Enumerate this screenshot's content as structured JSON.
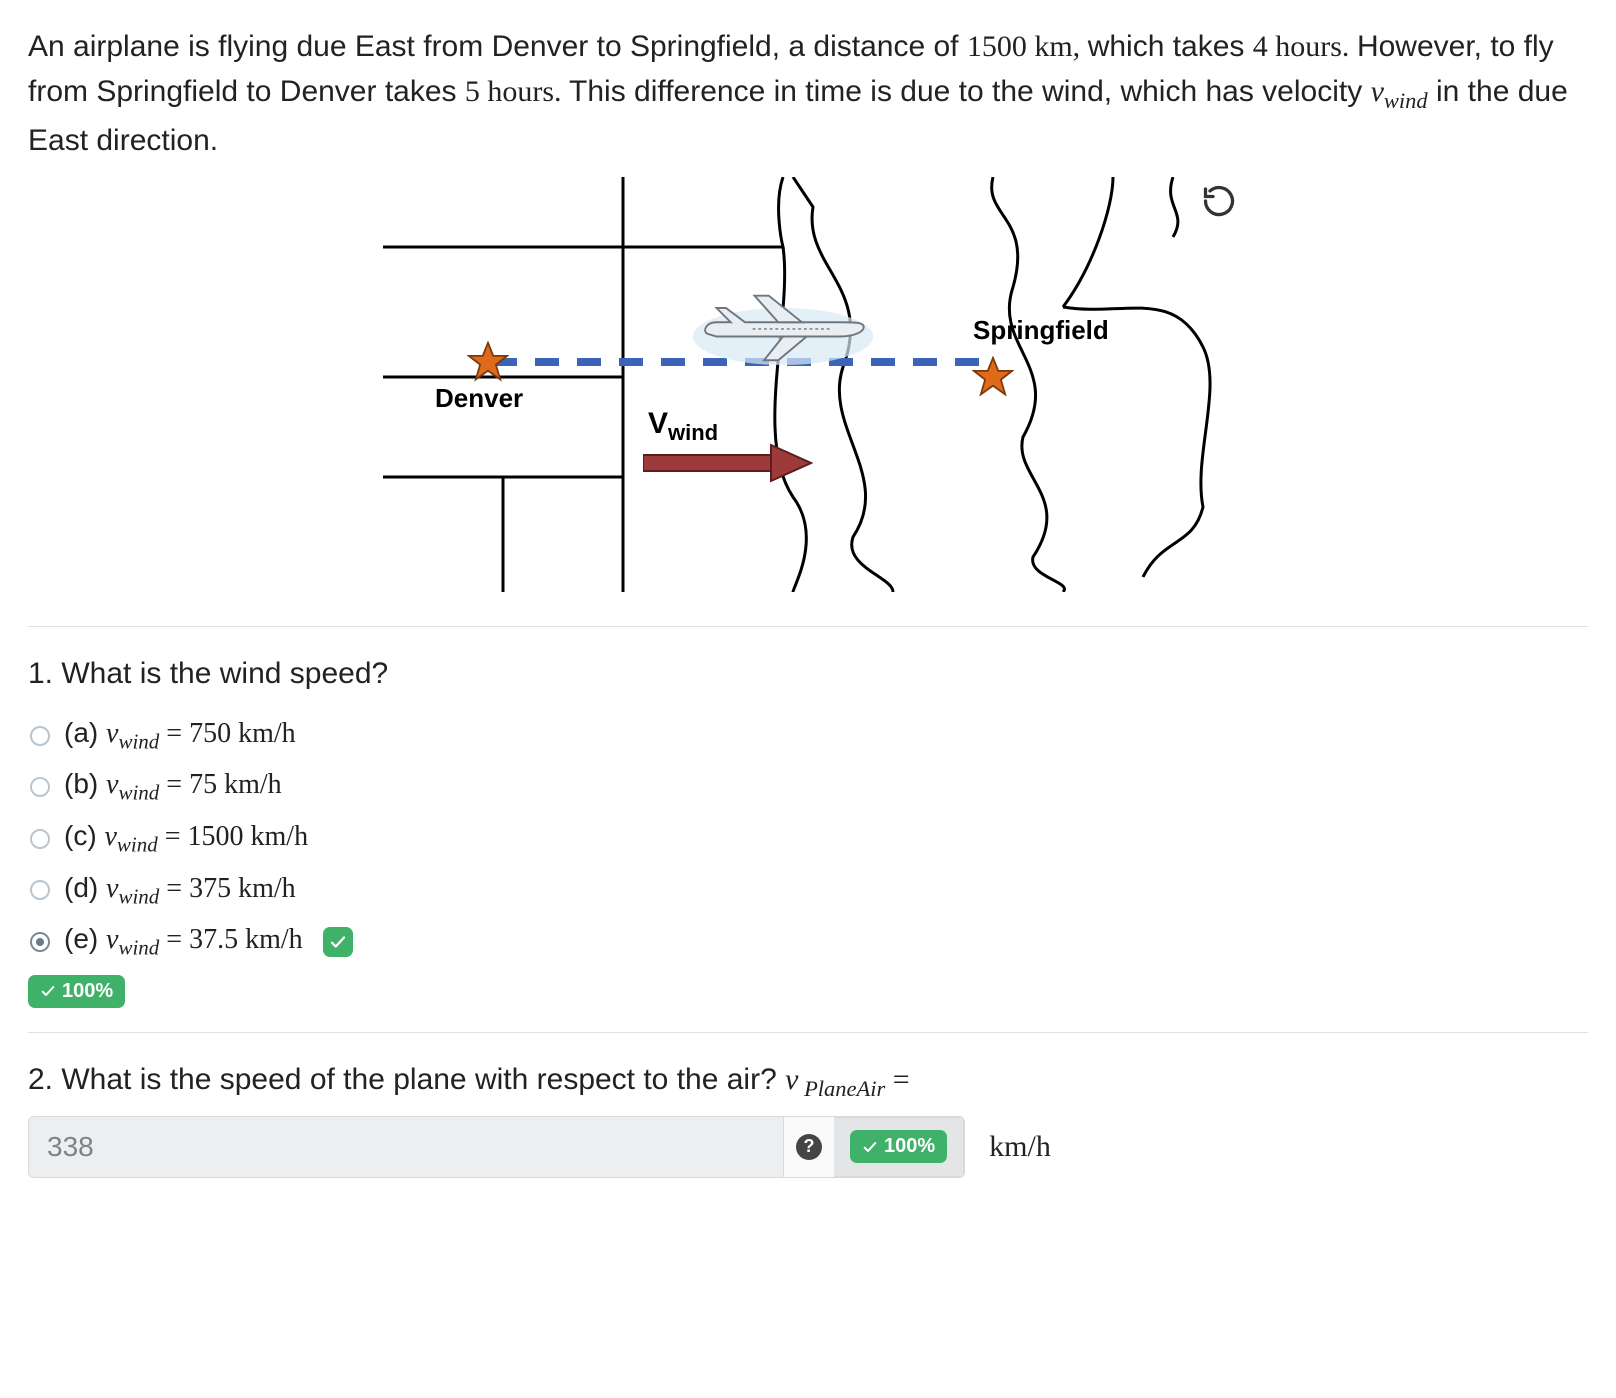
{
  "problem": {
    "intro_parts": [
      "An airplane is flying due East from Denver to Springfield, a distance of ",
      "which takes ",
      "However, to fly from Springfield to Denver takes ",
      "This difference in time is due to the wind, which has velocity ",
      " in the due East direction."
    ],
    "distance": "1500 km, ",
    "t_east": "4 hours. ",
    "t_west": "5 hours. ",
    "vwind_sym": "v",
    "vwind_sub": "wind"
  },
  "figure": {
    "city1": "Denver",
    "city2": "Springfield",
    "wind_label": "V",
    "wind_sub": "wind",
    "reset_icon": "reset-icon"
  },
  "q1": {
    "title": "1. What is the wind speed?",
    "options": [
      {
        "letter": "(a)",
        "value": "750 km/h",
        "selected": false,
        "correct": false
      },
      {
        "letter": "(b)",
        "value": "75 km/h",
        "selected": false,
        "correct": false
      },
      {
        "letter": "(c)",
        "value": "1500 km/h",
        "selected": false,
        "correct": false
      },
      {
        "letter": "(d)",
        "value": "375 km/h",
        "selected": false,
        "correct": false
      },
      {
        "letter": "(e)",
        "value": "37.5 km/h",
        "selected": true,
        "correct": true
      }
    ],
    "score_label": "100%"
  },
  "q2": {
    "title_prefix": "2. What is the speed of the plane with respect to the air? ",
    "var_sym": "v",
    "var_sub": " PlaneAir",
    "equals": " =",
    "answer_value": "338",
    "unit": "km/h",
    "score_label": "100%",
    "help": "?"
  }
}
